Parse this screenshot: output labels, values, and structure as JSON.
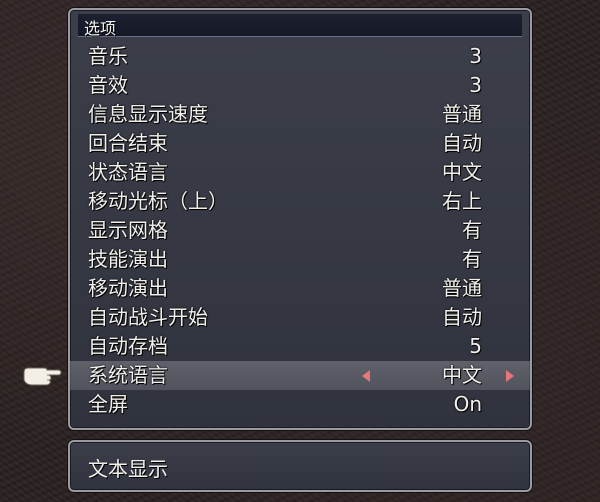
{
  "window": {
    "title": "选项"
  },
  "options": [
    {
      "label": "音乐",
      "value": "3"
    },
    {
      "label": "音效",
      "value": "3"
    },
    {
      "label": "信息显示速度",
      "value": "普通"
    },
    {
      "label": "回合结束",
      "value": "自动"
    },
    {
      "label": "状态语言",
      "value": "中文"
    },
    {
      "label": "移动光标（上）",
      "value": "右上"
    },
    {
      "label": "显示网格",
      "value": "有"
    },
    {
      "label": "技能演出",
      "value": "有"
    },
    {
      "label": "移动演出",
      "value": "普通"
    },
    {
      "label": "自动战斗开始",
      "value": "自动"
    },
    {
      "label": "自动存档",
      "value": "5"
    },
    {
      "label": "系统语言",
      "value": "中文"
    },
    {
      "label": "全屏",
      "value": "On"
    }
  ],
  "selected_index": 11,
  "cursor_icon": "pointing-hand-icon",
  "info": {
    "text": "文本显示"
  },
  "colors": {
    "arrow": "#e6767b",
    "panel": "#363944",
    "border": "#9a9aa0"
  }
}
